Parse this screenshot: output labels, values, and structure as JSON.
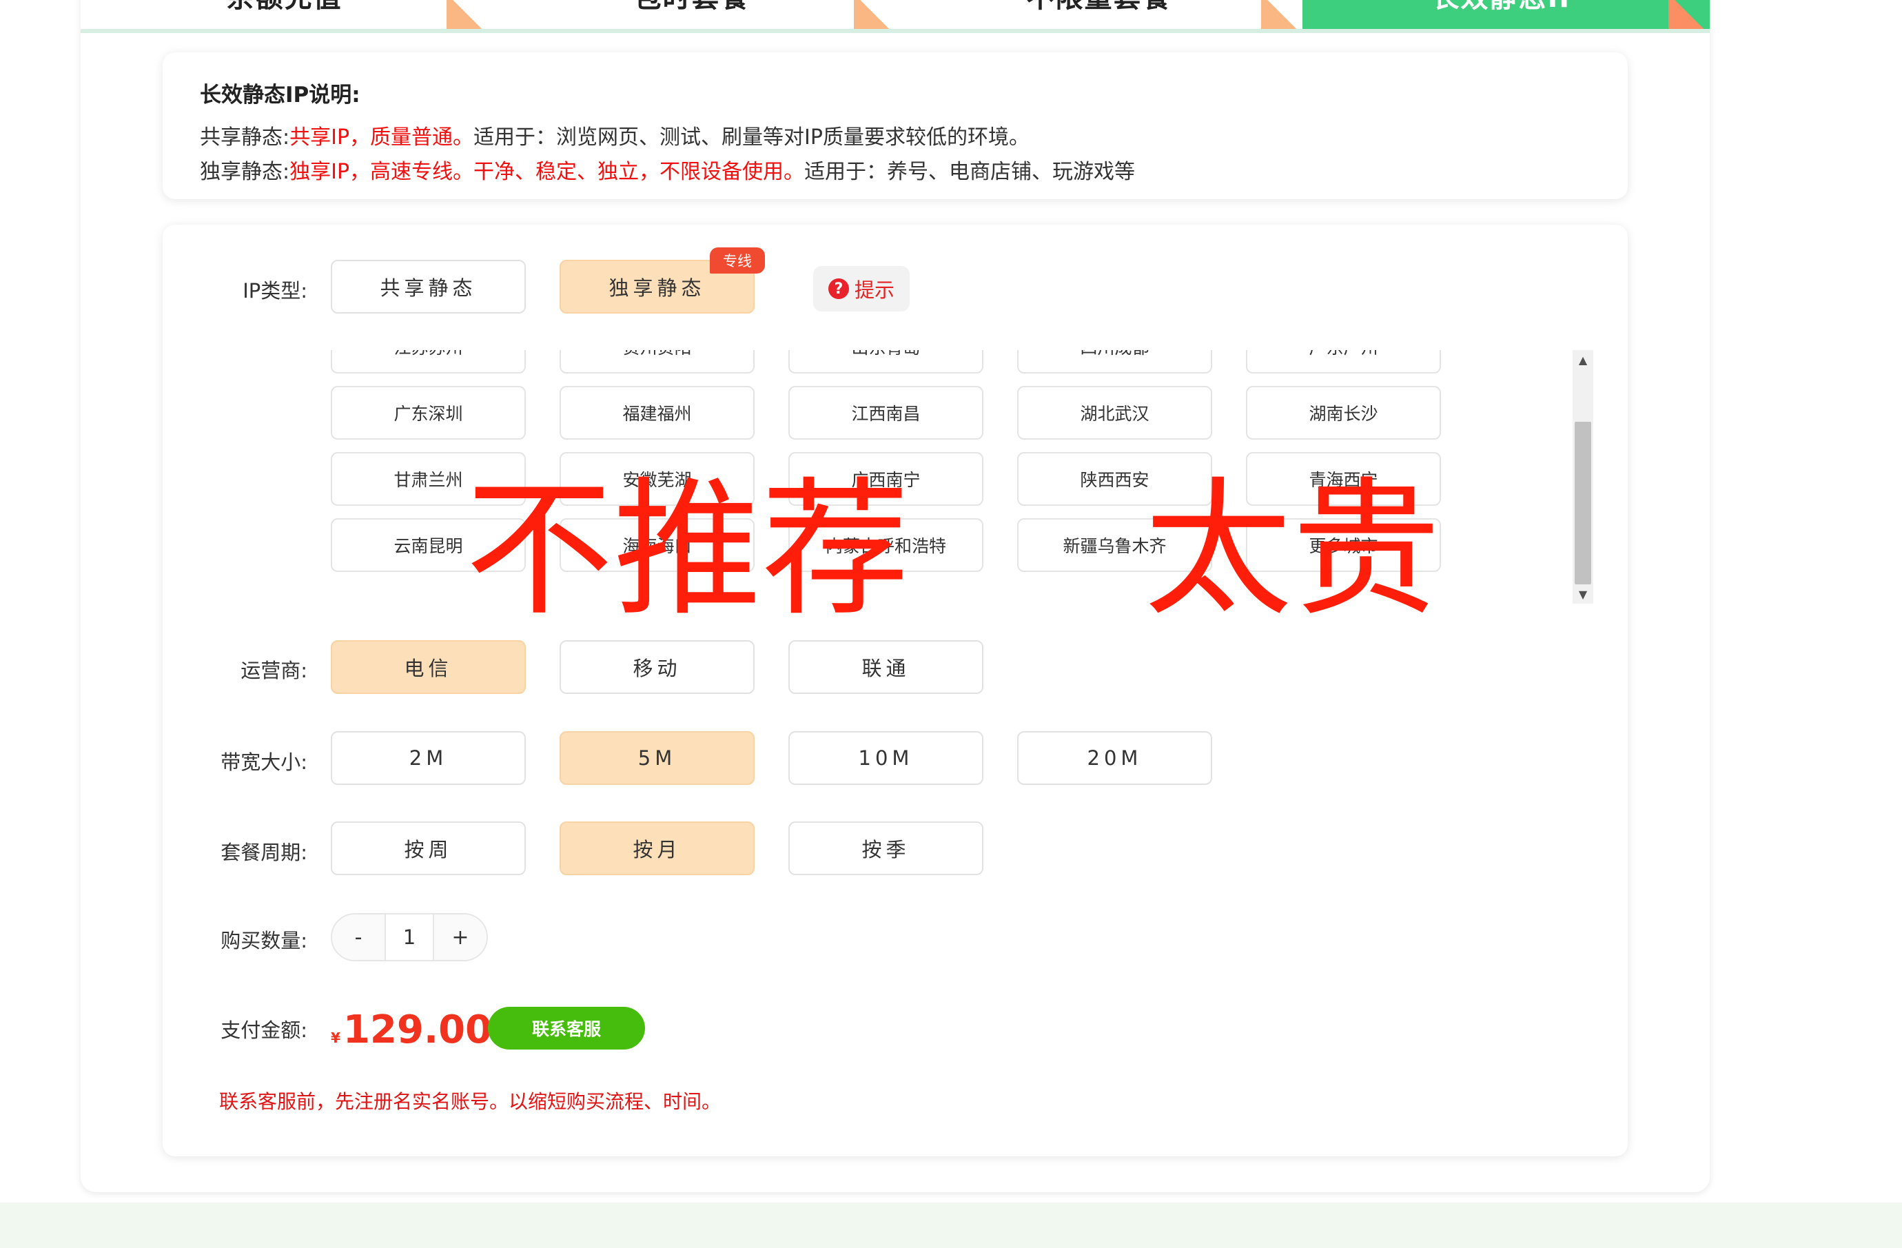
{
  "tabs": [
    {
      "label": "余额充值",
      "active": false
    },
    {
      "label": "包时套餐",
      "active": false
    },
    {
      "label": "不限量套餐",
      "active": false
    },
    {
      "label": "长效静态IP",
      "active": true
    }
  ],
  "info": {
    "title": "长效静态IP说明:",
    "shared": {
      "label": "共享静态:",
      "highlight": "共享IP，质量普通。",
      "rest": "适用于：浏览网页、测试、刷量等对IP质量要求较低的环境。"
    },
    "exclusive": {
      "label": "独享静态:",
      "highlight": "独享IP，高速专线。干净、稳定、独立，不限设备使用。",
      "rest": "适用于：养号、电商店铺、玩游戏等"
    }
  },
  "form": {
    "ip_type": {
      "label": "IP类型:",
      "options": [
        "共享静态",
        "独享静态"
      ],
      "selected": "独享静态",
      "badge": "专线",
      "hint": "提示"
    },
    "cities": [
      "江苏苏州",
      "贵州贵阳",
      "山东青岛",
      "四川成都",
      "广东广州",
      "广东深圳",
      "福建福州",
      "江西南昌",
      "湖北武汉",
      "湖南长沙",
      "甘肃兰州",
      "安徽芜湖",
      "广西南宁",
      "陕西西安",
      "青海西宁",
      "云南昆明",
      "海南海口",
      "内蒙古呼和浩特",
      "新疆乌鲁木齐",
      "更多城市"
    ],
    "carrier": {
      "label": "运营商:",
      "options": [
        "电信",
        "移动",
        "联通"
      ],
      "selected": "电信"
    },
    "bandwidth": {
      "label": "带宽大小:",
      "options": [
        "2M",
        "5M",
        "10M",
        "20M"
      ],
      "selected": "5M"
    },
    "period": {
      "label": "套餐周期:",
      "options": [
        "按周",
        "按月",
        "按季"
      ],
      "selected": "按月"
    },
    "quantity": {
      "label": "购买数量:",
      "minus": "-",
      "value": "1",
      "plus": "+"
    },
    "payment": {
      "label": "支付金额:",
      "currency": "¥",
      "amount": "129.00",
      "contact_button": "联系客服"
    },
    "notice": "联系客服前，先注册名实名账号。以缩短购买流程、时间。"
  },
  "watermark": {
    "left": "不推荐",
    "right": "太贵",
    "color": "#ff1e0a"
  },
  "icons": {
    "hint": "question-circle-icon",
    "scroll_up": "triangle-up-icon",
    "scroll_down": "triangle-down-icon"
  }
}
